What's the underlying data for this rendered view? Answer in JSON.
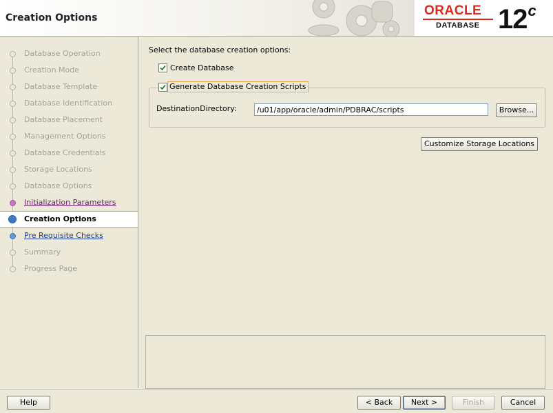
{
  "header": {
    "title": "Creation Options",
    "logo": {
      "brand": "ORACLE",
      "product": "DATABASE",
      "version": "12",
      "version_suffix": "c"
    }
  },
  "sidebar": {
    "steps": [
      {
        "label": "Database Operation",
        "state": "pending"
      },
      {
        "label": "Creation Mode",
        "state": "pending"
      },
      {
        "label": "Database Template",
        "state": "pending"
      },
      {
        "label": "Database Identification",
        "state": "pending"
      },
      {
        "label": "Database Placement",
        "state": "pending"
      },
      {
        "label": "Management Options",
        "state": "pending"
      },
      {
        "label": "Database Credentials",
        "state": "pending"
      },
      {
        "label": "Storage Locations",
        "state": "pending"
      },
      {
        "label": "Database Options",
        "state": "pending"
      },
      {
        "label": "Initialization Parameters",
        "state": "visited"
      },
      {
        "label": "Creation Options",
        "state": "current"
      },
      {
        "label": "Pre Requisite Checks",
        "state": "link"
      },
      {
        "label": "Summary",
        "state": "pending"
      },
      {
        "label": "Progress Page",
        "state": "pending"
      }
    ]
  },
  "main": {
    "intro": "Select the database creation options:",
    "create_database": {
      "label": "Create Database",
      "checked": true
    },
    "generate_scripts": {
      "label": "Generate Database Creation Scripts",
      "checked": true
    },
    "destination": {
      "label": "DestinationDirectory:",
      "value": "/u01/app/oracle/admin/PDBRAC/scripts"
    },
    "browse_label": "Browse...",
    "customize_label": "Customize Storage Locations"
  },
  "footer": {
    "help": "Help",
    "back": "< Back",
    "next": "Next >",
    "finish": "Finish",
    "cancel": "Cancel"
  },
  "colors": {
    "accent": "#3d78c9",
    "oracle_red": "#e0271b",
    "visited": "#6a1a6a",
    "link": "#1d3c8c"
  }
}
